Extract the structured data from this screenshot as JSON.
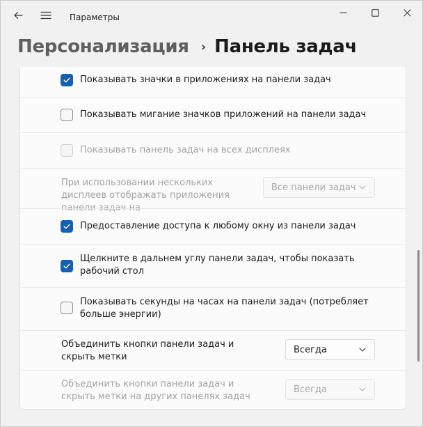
{
  "window": {
    "title": "Параметры",
    "icons": {
      "back": "back-arrow-icon",
      "menu": "hamburger-menu-icon",
      "minimize": "minimize-icon",
      "maximize": "maximize-icon",
      "close": "close-icon"
    }
  },
  "breadcrumb": {
    "parent": "Персонализация",
    "separator": "›",
    "current": "Панель задач"
  },
  "colors": {
    "accent": "#1660ad",
    "background": "#f1f1f1",
    "card": "#fbfbfb",
    "disabled_text": "#a3a3a3"
  },
  "settings": [
    {
      "label": "Показывать значки в приложениях на панели задач",
      "checked": true,
      "enabled": true
    },
    {
      "label": "Показывать мигание значков приложений на панели задач",
      "checked": false,
      "enabled": true
    },
    {
      "label": "Показывать панель задач на всех дисплеях",
      "checked": false,
      "enabled": false
    },
    {
      "label": "При использовании нескольких дисплеев отображать приложения панели задач на",
      "dropdown_value": "Все панели задач",
      "enabled": false
    },
    {
      "label": "Предоставление доступа к любому окну из панели задач",
      "checked": true,
      "enabled": true
    },
    {
      "label": "Щелкните в дальнем углу панели задач, чтобы показать рабочий стол",
      "checked": true,
      "enabled": true
    },
    {
      "label": "Показывать секунды на часах на панели задач (потребляет больше энергии)",
      "checked": false,
      "enabled": true
    },
    {
      "label": "Объединить кнопки панели задач и скрыть метки",
      "dropdown_value": "Всегда",
      "enabled": true
    },
    {
      "label": "Объединить кнопки панели задач и скрыть метки на других панелях задач",
      "dropdown_value": "Всегда",
      "enabled": false
    }
  ]
}
